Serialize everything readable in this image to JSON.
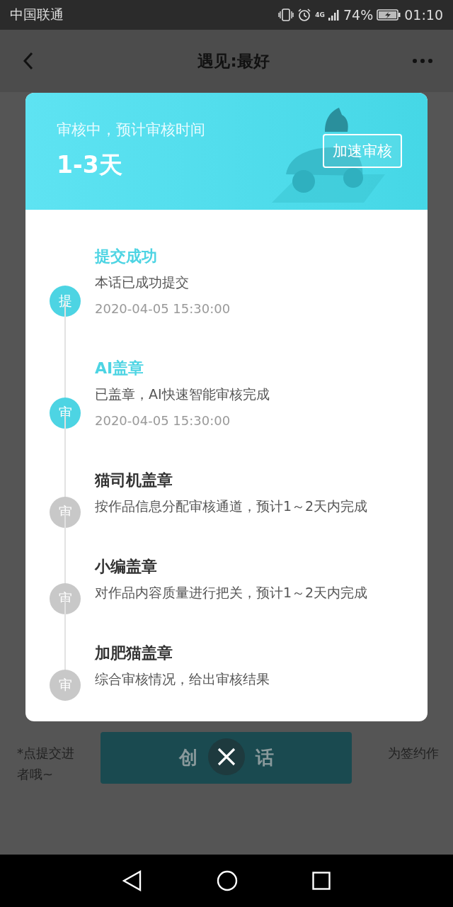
{
  "status_bar": {
    "carrier": "中国联通",
    "network": "4G",
    "battery": "74%",
    "time": "01:10"
  },
  "nav": {
    "title": "遇见:最好"
  },
  "background": {
    "note_left": "*点提交进",
    "note_right": "为签约作",
    "note_second": "者哦~",
    "button_parts": [
      "创",
      "话"
    ]
  },
  "dialog": {
    "subtitle": "审核中，预计审核时间",
    "duration": "1-3天",
    "speed_button": "加速审核",
    "steps": [
      {
        "badge": "提",
        "title": "提交成功",
        "desc": "本话已成功提交",
        "date": "2020-04-05 15:30:00",
        "done": true
      },
      {
        "badge": "审",
        "title": "AI盖章",
        "desc": "已盖章，AI快速智能审核完成",
        "date": "2020-04-05 15:30:00",
        "done": true
      },
      {
        "badge": "审",
        "title": "猫司机盖章",
        "desc": "按作品信息分配审核通道，预计1～2天内完成",
        "done": false
      },
      {
        "badge": "审",
        "title": "小编盖章",
        "desc": "对作品内容质量进行把关，预计1～2天内完成",
        "done": false
      },
      {
        "badge": "审",
        "title": "加肥猫盖章",
        "desc": "综合审核情况，给出审核结果",
        "done": false
      }
    ]
  }
}
